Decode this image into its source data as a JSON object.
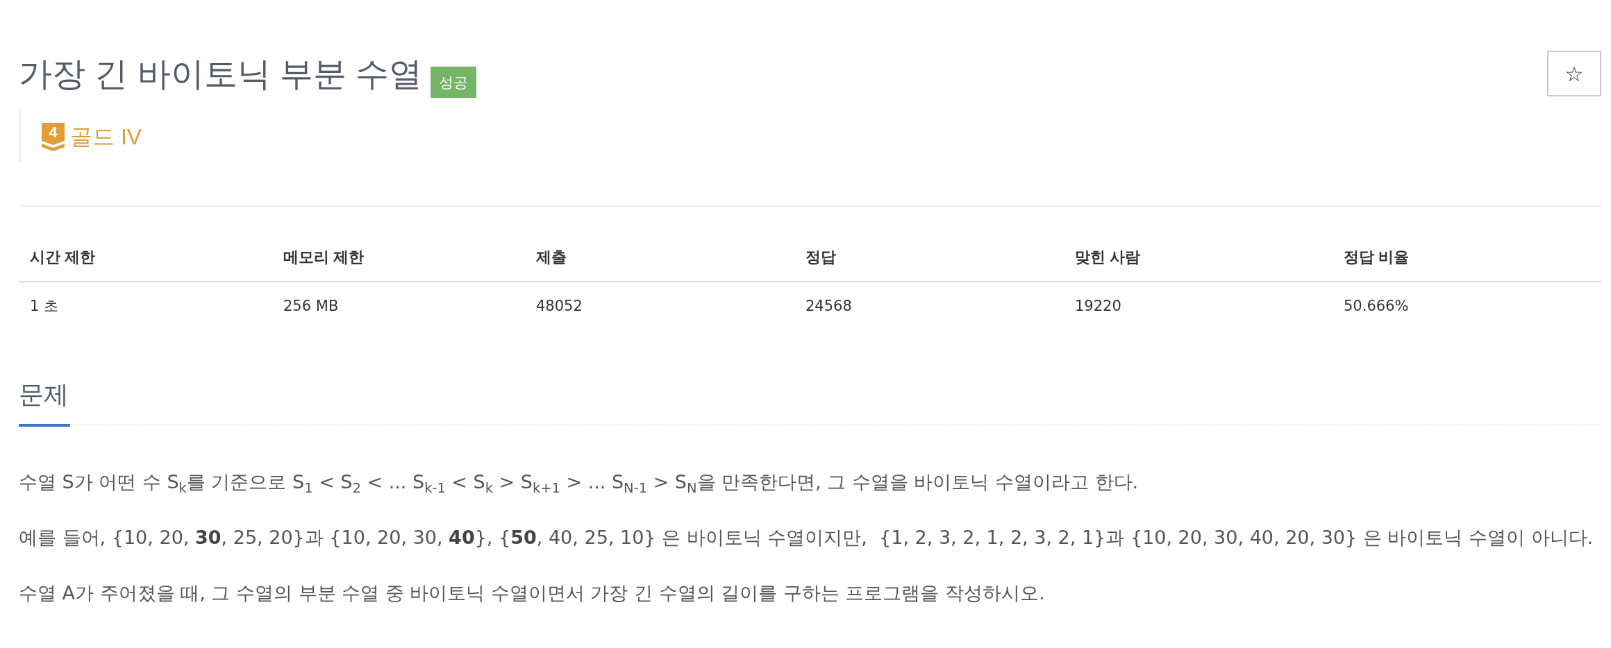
{
  "problem": {
    "title": "가장 긴 바이토닉 부분 수열",
    "result": {
      "label": "성공",
      "kind": "success"
    },
    "tier": {
      "number": "4",
      "label": "골드 IV",
      "kind": "gold"
    },
    "star_button": {
      "label": "☆"
    }
  },
  "info_table": {
    "columns": [
      "시간 제한",
      "메모리 제한",
      "제출",
      "정답",
      "맞힌 사람",
      "정답 비율"
    ],
    "rows": [
      [
        "1 초",
        "256 MB",
        "48052",
        "24568",
        "19220",
        "50.666%"
      ]
    ]
  },
  "section": {
    "title": "문제",
    "paragraphs": [
      "수열 S가 어떤 수 S$_{k}$를 기준으로 S$_{1}$ < S$_{2}$ < ... S$_{k-1}$ < S$_{k}$ > S$_{k+1}$ > ... S$_{N-1}$ > S$_{N}$을 만족한다면, 그 수열을 바이토닉 수열이라고 한다.",
      "예를 들어, {10, 20, **30**, 25, 20}과 {10, 20, 30, **40**}, {**50**, 40, 25, 10} 은 바이토닉 수열이지만,  {1, 2, 3, 2, 1, 2, 3, 2, 1}과 {10, 20, 30, 40, 20, 30} 은 바이토닉 수열이 아니다.",
      "수열 A가 주어졌을 때, 그 수열의 부분 수열 중 바이토닉 수열이면서 가장 긴 수열의 길이를 구하는 프로그램을 작성하시오."
    ]
  }
}
